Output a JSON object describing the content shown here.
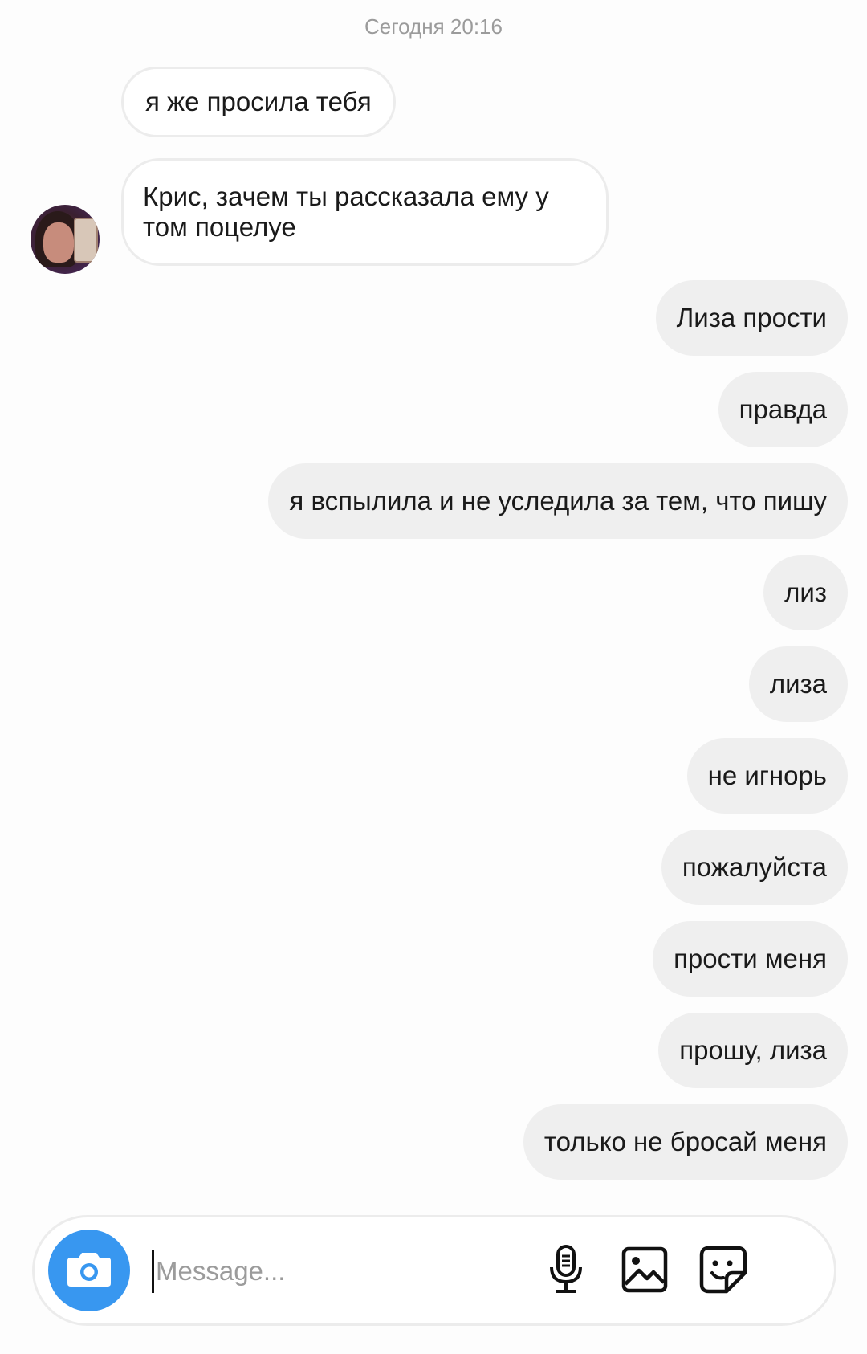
{
  "thread": {
    "timestamp": "Сегодня 20:16"
  },
  "messages": [
    {
      "text": "я же просила тебя",
      "direction": "incoming"
    },
    {
      "text": "Крис, зачем ты рассказала ему у том поцелуе",
      "direction": "incoming"
    },
    {
      "text": "Лиза прости",
      "direction": "outgoing"
    },
    {
      "text": "правда",
      "direction": "outgoing"
    },
    {
      "text": "я вспылила и не уследила за тем, что пишу",
      "direction": "outgoing"
    },
    {
      "text": "лиз",
      "direction": "outgoing"
    },
    {
      "text": "лиза",
      "direction": "outgoing"
    },
    {
      "text": "не игнорь",
      "direction": "outgoing"
    },
    {
      "text": "пожалуйста",
      "direction": "outgoing"
    },
    {
      "text": "прости меня",
      "direction": "outgoing"
    },
    {
      "text": "прошу, лиза",
      "direction": "outgoing"
    },
    {
      "text": "только не бросай меня",
      "direction": "outgoing"
    }
  ],
  "composer": {
    "placeholder": "Message...",
    "value": "",
    "camera_icon": "camera-icon",
    "mic_icon": "microphone-icon",
    "gallery_icon": "gallery-icon",
    "sticker_icon": "sticker-icon"
  },
  "colors": {
    "accent": "#3897f0",
    "outgoing_bubble": "#efefef",
    "incoming_border": "#ececec",
    "timestamp": "#9b9b9b"
  }
}
